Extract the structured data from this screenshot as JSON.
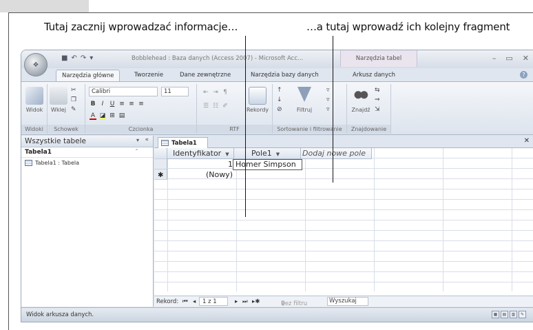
{
  "annotations": {
    "left": "Tutaj zacznij wprowadzać informacje…",
    "right": "…a tutaj wprowadź ich kolejny fragment"
  },
  "window": {
    "title": "Bobblehead : Baza danych (Access 2007) - Microsoft Acc...",
    "contextual_tab_header": "Narzędzia tabel"
  },
  "ribbon_tabs": [
    "Narzędzia główne",
    "Tworzenie",
    "Dane zewnętrzne",
    "Narzędzia bazy danych",
    "Arkusz danych"
  ],
  "ribbon": {
    "views_button": "Widok",
    "views_group": "Widoki",
    "paste_button": "Wklej",
    "clipboard_group": "Schowek",
    "font_name": "Calibri",
    "font_size": "11",
    "font_group": "Czcionka",
    "rtf_group": "RTF",
    "records_button": "Rekordy",
    "filter_button": "Filtruj",
    "sort_group": "Sortowanie i filtrowanie",
    "find_button": "Znajdź",
    "find_group": "Znajdowanie"
  },
  "nav_pane": {
    "header": "Wszystkie tabele",
    "group": "Tabela1",
    "item": "Tabela1 : Tabela"
  },
  "document": {
    "tab": "Tabela1",
    "columns": [
      "Identyfikator",
      "Pole1",
      "Dodaj nowe pole"
    ],
    "row1_id": "1",
    "row1_pole1": "Homer Simpson",
    "new_row_label": "(Nowy)"
  },
  "record_nav": {
    "label": "Rekord:",
    "position": "1 z 1",
    "filter": "Bez filtru",
    "search": "Wyszukaj"
  },
  "statusbar": {
    "text": "Widok arkusza danych."
  }
}
